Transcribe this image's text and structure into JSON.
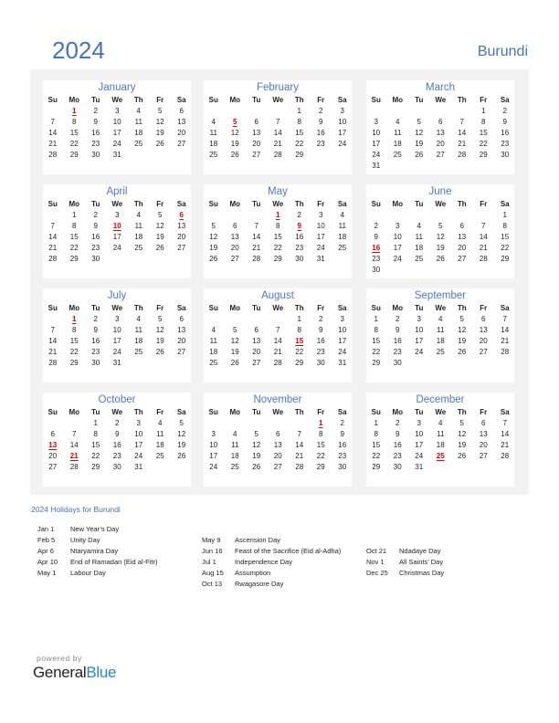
{
  "header": {
    "year": "2024",
    "country": "Burundi"
  },
  "weekday_labels": [
    "Su",
    "Mo",
    "Tu",
    "We",
    "Th",
    "Fr",
    "Sa"
  ],
  "colors": {
    "accent": "#4472c4",
    "holiday": "#e00000",
    "panel": "#f2f2f2"
  },
  "months": [
    {
      "name": "January",
      "start": 1,
      "days": 31,
      "holidays": [
        1
      ]
    },
    {
      "name": "February",
      "start": 4,
      "days": 29,
      "holidays": [
        5
      ]
    },
    {
      "name": "March",
      "start": 5,
      "days": 31,
      "holidays": []
    },
    {
      "name": "April",
      "start": 1,
      "days": 30,
      "holidays": [
        6,
        10
      ]
    },
    {
      "name": "May",
      "start": 3,
      "days": 31,
      "holidays": [
        1,
        9
      ]
    },
    {
      "name": "June",
      "start": 6,
      "days": 30,
      "holidays": [
        16
      ]
    },
    {
      "name": "July",
      "start": 1,
      "days": 31,
      "holidays": [
        1
      ]
    },
    {
      "name": "August",
      "start": 4,
      "days": 31,
      "holidays": [
        15
      ]
    },
    {
      "name": "September",
      "start": 0,
      "days": 30,
      "holidays": []
    },
    {
      "name": "October",
      "start": 2,
      "days": 31,
      "holidays": [
        13,
        21
      ]
    },
    {
      "name": "November",
      "start": 5,
      "days": 30,
      "holidays": [
        1
      ]
    },
    {
      "name": "December",
      "start": 0,
      "days": 31,
      "holidays": [
        25
      ]
    }
  ],
  "holidays_title": "2024 Holidays for Burundi",
  "holiday_columns": [
    [
      {
        "date": "Jan 1",
        "name": "New Year’s Day"
      },
      {
        "date": "Feb 5",
        "name": "Unity Day"
      },
      {
        "date": "Apr 6",
        "name": "Ntaryamira Day"
      },
      {
        "date": "Apr 10",
        "name": "End of Ramadan (Eid al-Fitr)"
      },
      {
        "date": "May 1",
        "name": "Labour Day"
      }
    ],
    [
      {
        "date": "May 9",
        "name": "Ascension Day"
      },
      {
        "date": "Jun 16",
        "name": "Feast of the Sacrifice (Eid al-Adha)"
      },
      {
        "date": "Jul 1",
        "name": "Independence Day"
      },
      {
        "date": "Aug 15",
        "name": "Assumption"
      },
      {
        "date": "Oct 13",
        "name": "Rwagasore Day"
      }
    ],
    [
      {
        "date": "Oct 21",
        "name": "Ndadaye Day"
      },
      {
        "date": "Nov 1",
        "name": "All Saints’ Day"
      },
      {
        "date": "Dec 25",
        "name": "Christmas Day"
      }
    ]
  ],
  "footer": {
    "powered_by": "powered by",
    "brand_general": "General",
    "brand_blue": "Blue"
  }
}
